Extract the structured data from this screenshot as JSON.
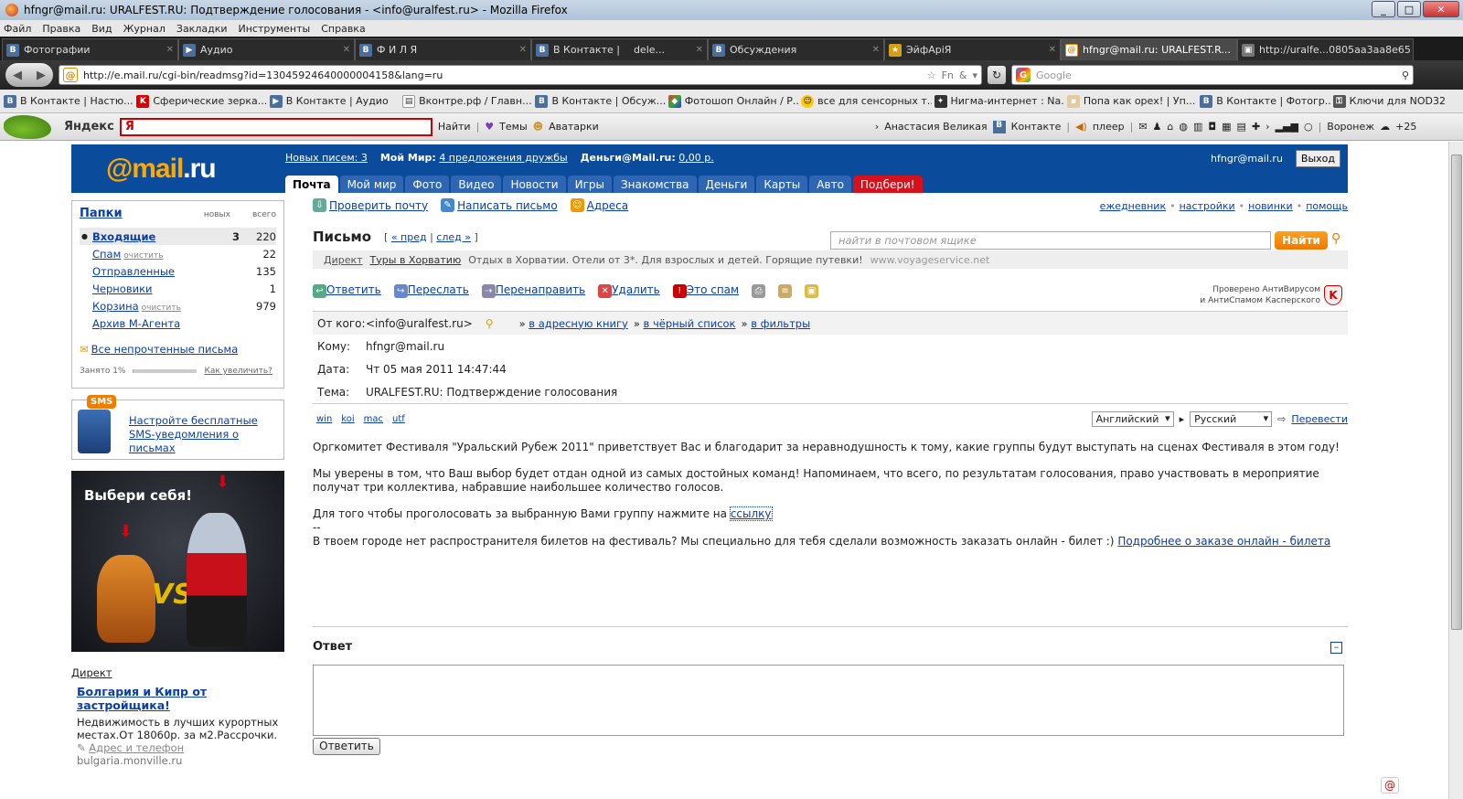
{
  "window": {
    "title": "hfngr@mail.ru: URALFEST.RU: Подтверждение голосования - <info@uralfest.ru> - Mozilla Firefox",
    "menu": [
      "Файл",
      "Правка",
      "Вид",
      "Журнал",
      "Закладки",
      "Инструменты",
      "Справка"
    ]
  },
  "tabs": [
    {
      "icon": "B",
      "label": "Фотографии"
    },
    {
      "icon": "▶",
      "label": "Аудио"
    },
    {
      "icon": "B",
      "label": "Ф И Л Я"
    },
    {
      "icon": "B",
      "label": "В Контакте |"
    },
    {
      "icon": "◆",
      "label": "dele..."
    },
    {
      "icon": "B",
      "label": "Обсуждения"
    },
    {
      "icon": "★",
      "label": "ЭйфАрiЯ"
    },
    {
      "icon": "@",
      "label": "hfngr@mail.ru: URALFEST.R..."
    },
    {
      "icon": "▣",
      "label": "http://uralfe...0805aa3aa8e65"
    }
  ],
  "address": {
    "url": "http://e.mail.ru/cgi-bin/readmsg?id=13045924640000004158&lang=ru",
    "search_placeholder": "Google"
  },
  "bookmarks": [
    "В Контакте | Настю...",
    "Сферические зерка...",
    "В Контакте | Аудио",
    "Вконтре.рф / Главн...",
    "В Контакте | Обсуж...",
    "Фотошоп Онлайн / Р...",
    "все для сенсорных т...",
    "Нигма-интернет : Na...",
    "Попа как орех! | Уп...",
    "В Контакте | Фотогр...",
    "Ключи для NOD32"
  ],
  "yandex": {
    "logo": "Яндекс",
    "input": "Я",
    "find": "Найти",
    "themes": "Темы",
    "avatars": "Аватарки",
    "user": "Анастасия Великая",
    "vk": "Контакте",
    "player": "плеер",
    "city": "Воронеж",
    "temp": "+25"
  },
  "mail": {
    "logo_at": "@mail",
    "logo_ru": ".ru",
    "new_letters": "Новых писем: 3",
    "my_world_label": "Мой Мир:",
    "my_world_link": "4 предложения дружбы",
    "money_label": "Деньги@Mail.ru:",
    "money_link": "0,00 р.",
    "user_email": "hfngr@mail.ru",
    "exit": "Выход",
    "tabs": [
      "Почта",
      "Мой мир",
      "Фото",
      "Видео",
      "Новости",
      "Игры",
      "Знакомства",
      "Деньги",
      "Карты",
      "Авто",
      "Подбери!"
    ]
  },
  "folders": {
    "title": "Папки",
    "col_new": "новых",
    "col_total": "всего",
    "items": [
      {
        "name": "Входящие",
        "clean": "",
        "new": "3",
        "total": "220"
      },
      {
        "name": "Спам",
        "clean": "очистить",
        "new": "",
        "total": "22"
      },
      {
        "name": "Отправленные",
        "clean": "",
        "new": "",
        "total": "135"
      },
      {
        "name": "Черновики",
        "clean": "",
        "new": "",
        "total": "1"
      },
      {
        "name": "Корзина",
        "clean": "очистить",
        "new": "",
        "total": "979"
      },
      {
        "name": "Архив М-Агента",
        "clean": "",
        "new": "",
        "total": ""
      }
    ],
    "all_unread": "Все непрочтенные письма",
    "quota": "Занято 1%",
    "quota_fraction": 0.01,
    "enlarge": "Как увеличить?"
  },
  "sms": {
    "tag": "SMS",
    "line1": "Настройте бесплатные",
    "line2": "SMS-уведомления о письмах"
  },
  "promo": {
    "title": "Выбери себя!",
    "vs": "VS"
  },
  "direct": {
    "label": "Директ",
    "ad_title": "Болгария и Кипр от застройщика!",
    "ad_text": "Недвижимость в лучших курортных местах.От 18060р. за м2.Рассрочки.",
    "ad_link": "Адрес и телефон",
    "ad_domain": "bulgaria.monville.ru"
  },
  "toolbar": {
    "check": "Проверить почту",
    "write": "Написать письмо",
    "addresses": "Адреса",
    "right_links": [
      "ежедневник",
      "настройки",
      "новинки",
      "помощь"
    ]
  },
  "message": {
    "heading": "Письмо",
    "prev": "« пред",
    "next": "след »",
    "search_placeholder": "найти в почтовом ящике",
    "find": "Найти",
    "ad_direct": "Директ",
    "ad_title": "Туры в Хорватию",
    "ad_text": "Отдых в Хорватии. Отели от 3*. Для взрослых и детей. Горящие путевки!",
    "ad_domain": "www.voyageservice.net",
    "actions": [
      "Ответить",
      "Переслать",
      "Перенаправить",
      "Удалить",
      "Это спам"
    ],
    "kasp1": "Проверено АнтиВирусом",
    "kasp2": "и АнтиСпамом Касперского",
    "from_label": "От кого:",
    "from": "<info@uralfest.ru>",
    "from_actions": [
      "в адресную книгу",
      "в чёрный список",
      "в фильтры"
    ],
    "to_label": "Кому:",
    "to": "hfngr@mail.ru",
    "date_label": "Дата:",
    "date": "Чт 05 мая 2011 14:47:44",
    "subject_label": "Тема:",
    "subject": "URALFEST.RU: Подтверждение голосования",
    "encodings": [
      "win",
      "koi",
      "mac",
      "utf"
    ],
    "lang_from": "Английский",
    "lang_to": "Русский",
    "translate": "Перевести",
    "p1": "Оргкомитет Фестиваля \"Уральский Рубеж 2011\" приветствует Вас и благодарит за неравнодушность к тому, какие группы будут выступать на сценах Фестиваля в этом году!",
    "p2": "Мы уверены в том, что Ваш выбор будет отдан одной из самых достойных команд! Напоминаем, что всего, по результатам голосования, право участвовать в мероприятие получат три коллектива, набравшие наибольшее количество голосов.",
    "p3": "Для того чтобы проголосовать за выбранную Вами группу нажмите на",
    "p3_link": "ссылку",
    "dash": "--",
    "p4": "В твоем городе нет распространителя билетов на фестиваль? Мы специально для тебя сделали возможность заказать онлайн - билет :)",
    "p4_link": "Подробнее о заказе онлайн - билета"
  },
  "reply": {
    "title": "Ответ",
    "button": "Ответить"
  }
}
